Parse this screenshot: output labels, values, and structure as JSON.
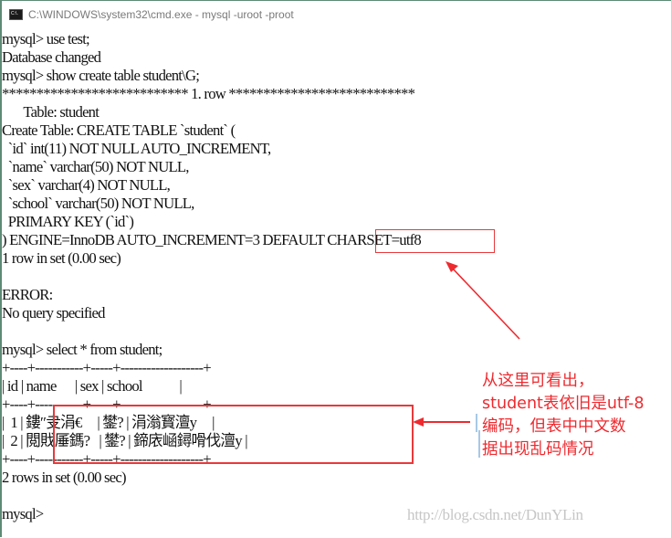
{
  "window": {
    "title": "C:\\WINDOWS\\system32\\cmd.exe - mysql  -uroot -proot",
    "icon": "cmd-icon"
  },
  "terminal": {
    "lines": [
      "mysql> use test;",
      "Database changed",
      "mysql> show create table student\\G;",
      "*************************** 1. row ***************************",
      "       Table: student",
      "Create Table: CREATE TABLE `student` (",
      "  `id` int(11) NOT NULL AUTO_INCREMENT,",
      "  `name` varchar(50) NOT NULL,",
      "  `sex` varchar(4) NOT NULL,",
      "  `school` varchar(50) NOT NULL,",
      "  PRIMARY KEY (`id`)",
      ") ENGINE=InnoDB AUTO_INCREMENT=3 DEFAULT CHARSET=utf8",
      "1 row in set (0.00 sec)",
      "",
      "ERROR:",
      "No query specified",
      "",
      "mysql> select * from student;",
      "+----+-----------+-----+-------------------+",
      "| id | name      | sex | school            |",
      "+----+-----------+-----+-------------------+",
      "|  1 | 鏤″叏涓€     | 鐢? | 涓滃寳澶у     |",
      "|  2 | 閲戝厜鎷?   | 鐢? | 鍗庡崡鐞嗗伐澶у |",
      "+----+-----------+-----+-------------------+",
      "2 rows in set (0.00 sec)",
      "",
      "mysql> "
    ],
    "highlight": "CHARSET=utf8",
    "result_table": {
      "columns": [
        "id",
        "name",
        "sex",
        "school"
      ],
      "rows": [
        [
          "1",
          "鏤″叏涓€",
          "鐢?",
          "涓滃寳澶у"
        ],
        [
          "2",
          "閲戝厜鎷?",
          "鐢?",
          "鍗庡崡鐞嗗伐澶у"
        ]
      ],
      "summary": "2 rows in set (0.00 sec)"
    }
  },
  "annotation": {
    "lines": [
      "从这里可看出，",
      "student表依旧是utf-8",
      "编码，但表中中文数",
      "据出现乱码情况"
    ],
    "color": "#ee2a2f"
  },
  "watermark": "http://blog.csdn.net/DunYLin"
}
